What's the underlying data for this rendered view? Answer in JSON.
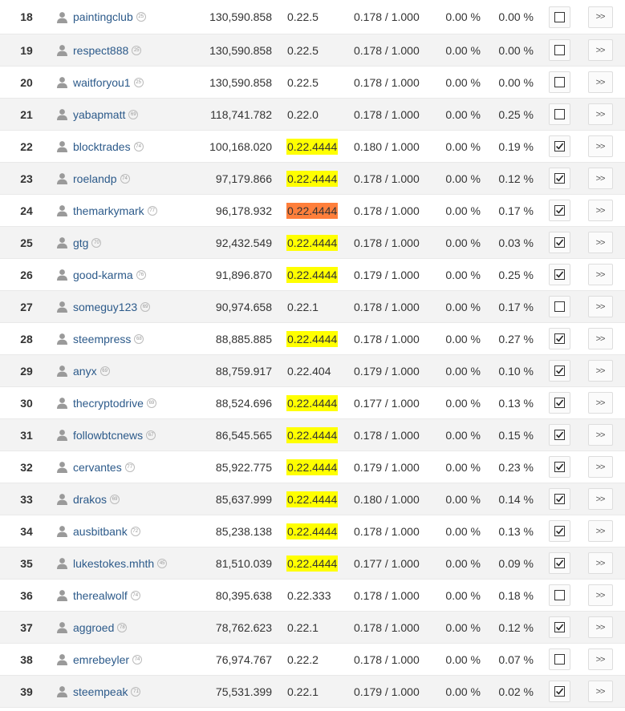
{
  "rows": [
    {
      "rank": "18",
      "name": "paintingclub",
      "rep": "25",
      "votes": "130,590.858",
      "version": "0.22.5",
      "version_highlight": "none",
      "feed": "0.178 / 1.000",
      "pct1": "0.00 %",
      "pct2": "0.00 %",
      "checked": false,
      "more_label": ">>"
    },
    {
      "rank": "19",
      "name": "respect888",
      "rep": "25",
      "votes": "130,590.858",
      "version": "0.22.5",
      "version_highlight": "none",
      "feed": "0.178 / 1.000",
      "pct1": "0.00 %",
      "pct2": "0.00 %",
      "checked": false,
      "more_label": ">>"
    },
    {
      "rank": "20",
      "name": "waitforyou1",
      "rep": "25",
      "votes": "130,590.858",
      "version": "0.22.5",
      "version_highlight": "none",
      "feed": "0.178 / 1.000",
      "pct1": "0.00 %",
      "pct2": "0.00 %",
      "checked": false,
      "more_label": ">>"
    },
    {
      "rank": "21",
      "name": "yabapmatt",
      "rep": "69",
      "votes": "118,741.782",
      "version": "0.22.0",
      "version_highlight": "none",
      "feed": "0.178 / 1.000",
      "pct1": "0.00 %",
      "pct2": "0.25 %",
      "checked": false,
      "more_label": ">>"
    },
    {
      "rank": "22",
      "name": "blocktrades",
      "rep": "74",
      "votes": "100,168.020",
      "version": "0.22.4444",
      "version_highlight": "yellow",
      "feed": "0.180 / 1.000",
      "pct1": "0.00 %",
      "pct2": "0.19 %",
      "checked": true,
      "more_label": ">>"
    },
    {
      "rank": "23",
      "name": "roelandp",
      "rep": "74",
      "votes": "97,179.866",
      "version": "0.22.4444",
      "version_highlight": "yellow",
      "feed": "0.178 / 1.000",
      "pct1": "0.00 %",
      "pct2": "0.12 %",
      "checked": true,
      "more_label": ">>"
    },
    {
      "rank": "24",
      "name": "themarkymark",
      "rep": "77",
      "votes": "96,178.932",
      "version": "0.22.4444",
      "version_highlight": "orange",
      "feed": "0.178 / 1.000",
      "pct1": "0.00 %",
      "pct2": "0.17 %",
      "checked": true,
      "more_label": ">>"
    },
    {
      "rank": "25",
      "name": "gtg",
      "rep": "70",
      "votes": "92,432.549",
      "version": "0.22.4444",
      "version_highlight": "yellow",
      "feed": "0.178 / 1.000",
      "pct1": "0.00 %",
      "pct2": "0.03 %",
      "checked": true,
      "more_label": ">>"
    },
    {
      "rank": "26",
      "name": "good-karma",
      "rep": "76",
      "votes": "91,896.870",
      "version": "0.22.4444",
      "version_highlight": "yellow",
      "feed": "0.179 / 1.000",
      "pct1": "0.00 %",
      "pct2": "0.25 %",
      "checked": true,
      "more_label": ">>"
    },
    {
      "rank": "27",
      "name": "someguy123",
      "rep": "69",
      "votes": "90,974.658",
      "version": "0.22.1",
      "version_highlight": "none",
      "feed": "0.178 / 1.000",
      "pct1": "0.00 %",
      "pct2": "0.17 %",
      "checked": false,
      "more_label": ">>"
    },
    {
      "rank": "28",
      "name": "steempress",
      "rep": "68",
      "votes": "88,885.885",
      "version": "0.22.4444",
      "version_highlight": "yellow",
      "feed": "0.178 / 1.000",
      "pct1": "0.00 %",
      "pct2": "0.27 %",
      "checked": true,
      "more_label": ">>"
    },
    {
      "rank": "29",
      "name": "anyx",
      "rep": "69",
      "votes": "88,759.917",
      "version": "0.22.404",
      "version_highlight": "none",
      "feed": "0.179 / 1.000",
      "pct1": "0.00 %",
      "pct2": "0.10 %",
      "checked": true,
      "more_label": ">>"
    },
    {
      "rank": "30",
      "name": "thecryptodrive",
      "rep": "69",
      "votes": "88,524.696",
      "version": "0.22.4444",
      "version_highlight": "yellow",
      "feed": "0.177 / 1.000",
      "pct1": "0.00 %",
      "pct2": "0.13 %",
      "checked": true,
      "more_label": ">>"
    },
    {
      "rank": "31",
      "name": "followbtcnews",
      "rep": "67",
      "votes": "86,545.565",
      "version": "0.22.4444",
      "version_highlight": "yellow",
      "feed": "0.178 / 1.000",
      "pct1": "0.00 %",
      "pct2": "0.15 %",
      "checked": true,
      "more_label": ">>"
    },
    {
      "rank": "32",
      "name": "cervantes",
      "rep": "77",
      "votes": "85,922.775",
      "version": "0.22.4444",
      "version_highlight": "yellow",
      "feed": "0.179 / 1.000",
      "pct1": "0.00 %",
      "pct2": "0.23 %",
      "checked": true,
      "more_label": ">>"
    },
    {
      "rank": "33",
      "name": "drakos",
      "rep": "69",
      "votes": "85,637.999",
      "version": "0.22.4444",
      "version_highlight": "yellow",
      "feed": "0.180 / 1.000",
      "pct1": "0.00 %",
      "pct2": "0.14 %",
      "checked": true,
      "more_label": ">>"
    },
    {
      "rank": "34",
      "name": "ausbitbank",
      "rep": "72",
      "votes": "85,238.138",
      "version": "0.22.4444",
      "version_highlight": "yellow",
      "feed": "0.178 / 1.000",
      "pct1": "0.00 %",
      "pct2": "0.13 %",
      "checked": true,
      "more_label": ">>"
    },
    {
      "rank": "35",
      "name": "lukestokes.mhth",
      "rep": "45",
      "votes": "81,510.039",
      "version": "0.22.4444",
      "version_highlight": "yellow",
      "feed": "0.177 / 1.000",
      "pct1": "0.00 %",
      "pct2": "0.09 %",
      "checked": true,
      "more_label": ">>"
    },
    {
      "rank": "36",
      "name": "therealwolf",
      "rep": "74",
      "votes": "80,395.638",
      "version": "0.22.333",
      "version_highlight": "none",
      "feed": "0.178 / 1.000",
      "pct1": "0.00 %",
      "pct2": "0.18 %",
      "checked": false,
      "more_label": ">>"
    },
    {
      "rank": "37",
      "name": "aggroed",
      "rep": "78",
      "votes": "78,762.623",
      "version": "0.22.1",
      "version_highlight": "none",
      "feed": "0.178 / 1.000",
      "pct1": "0.00 %",
      "pct2": "0.12 %",
      "checked": true,
      "more_label": ">>"
    },
    {
      "rank": "38",
      "name": "emrebeyler",
      "rep": "74",
      "votes": "76,974.767",
      "version": "0.22.2",
      "version_highlight": "none",
      "feed": "0.178 / 1.000",
      "pct1": "0.00 %",
      "pct2": "0.07 %",
      "checked": false,
      "more_label": ">>"
    },
    {
      "rank": "39",
      "name": "steempeak",
      "rep": "71",
      "votes": "75,531.399",
      "version": "0.22.1",
      "version_highlight": "none",
      "feed": "0.179 / 1.000",
      "pct1": "0.00 %",
      "pct2": "0.02 %",
      "checked": true,
      "more_label": ">>"
    }
  ],
  "icons": {
    "user": "user-icon",
    "checkbox_checked": "checkbox-checked-icon",
    "checkbox_unchecked": "checkbox-unchecked-icon"
  },
  "colors": {
    "link": "#2c5a8a",
    "highlight_yellow": "#ffff00",
    "highlight_orange": "#ff7f3b",
    "row_alt": "#f3f3f3"
  }
}
